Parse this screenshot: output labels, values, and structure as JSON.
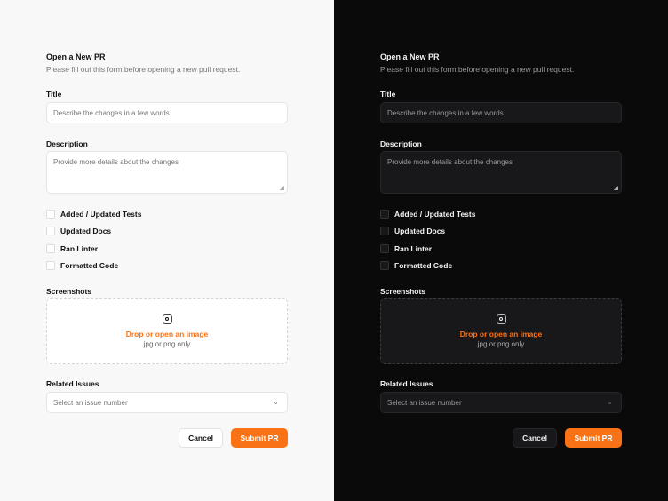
{
  "form": {
    "heading": "Open a New PR",
    "subtitle": "Please fill out this form before opening a new pull request.",
    "title_label": "Title",
    "title_placeholder": "Describe the changes in a few words",
    "description_label": "Description",
    "description_placeholder": "Provide more details about the changes",
    "checkboxes": [
      "Added / Updated Tests",
      "Updated Docs",
      "Ran Linter",
      "Formatted Code"
    ],
    "screenshots_label": "Screenshots",
    "drop_text": "Drop or open an image",
    "drop_hint": "jpg or png only",
    "issues_label": "Related Issues",
    "issues_placeholder": "Select an issue number",
    "cancel": "Cancel",
    "submit": "Submit PR"
  },
  "colors": {
    "accent": "#f97316",
    "light_bg": "#f8f8f8",
    "dark_bg": "#0a0a0b"
  }
}
